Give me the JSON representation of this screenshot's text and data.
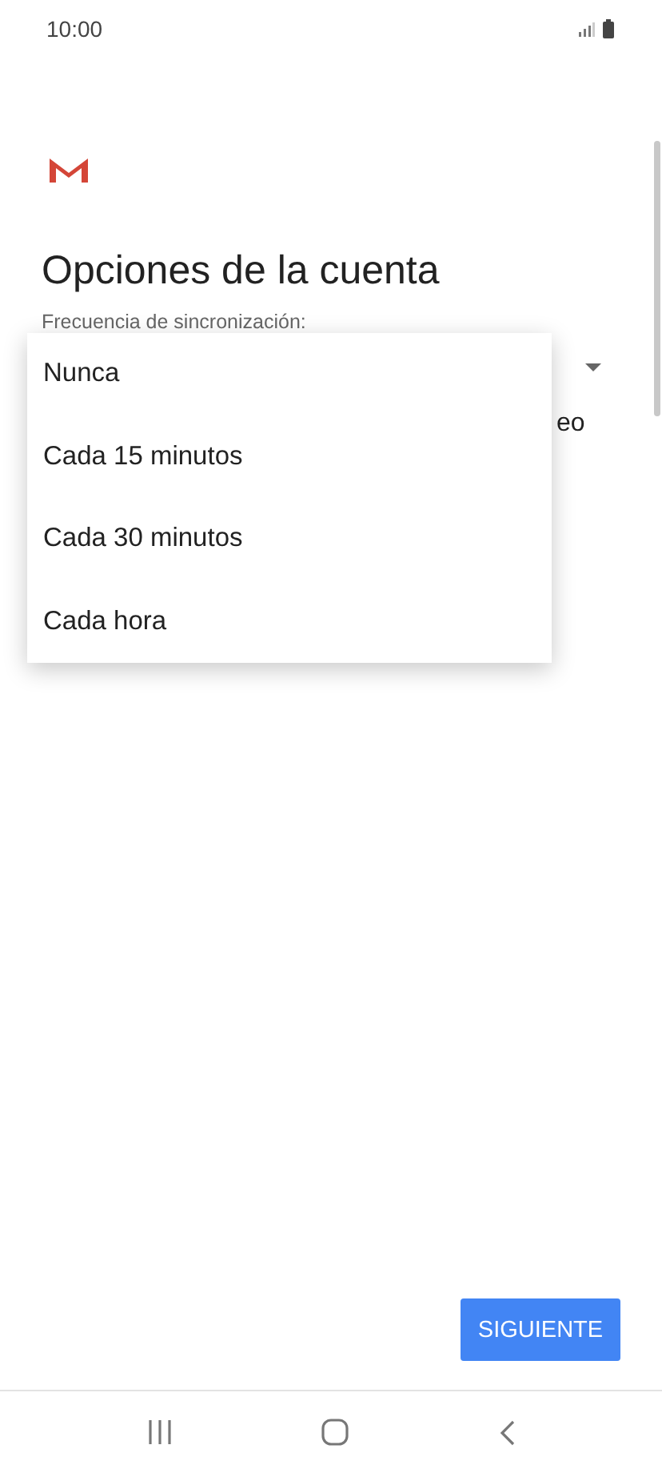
{
  "status_bar": {
    "time": "10:00"
  },
  "title": "Opciones de la cuenta",
  "sync_label": "Frecuencia de sincronización:",
  "hidden_row_text": "eo",
  "menu": {
    "items": [
      {
        "label": "Nunca"
      },
      {
        "label": "Cada 15 minutos"
      },
      {
        "label": "Cada 30 minutos"
      },
      {
        "label": "Cada hora"
      }
    ]
  },
  "next_button": "SIGUIENTE"
}
